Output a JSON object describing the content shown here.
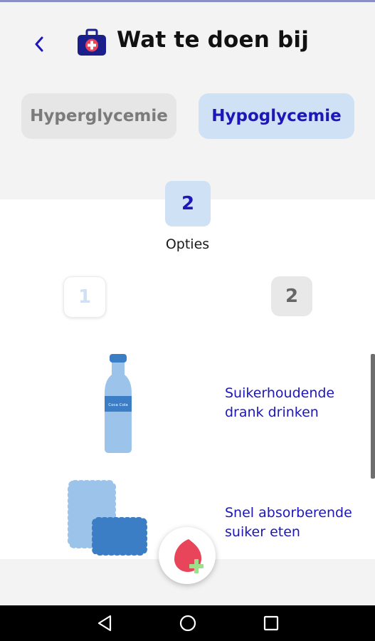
{
  "header": {
    "back_icon": "chevron-left-icon",
    "kit_icon": "first-aid-kit-icon",
    "title": "Wat te doen bij"
  },
  "segments": {
    "hyper_label": "Hyperglycemie",
    "hypo_label": "Hypoglycemie",
    "selected": "Hypoglycemie"
  },
  "options_count": {
    "value": "2",
    "label": "Opties"
  },
  "steps": {
    "step1": "1",
    "step2": "2"
  },
  "options": [
    {
      "icon": "bottle-icon",
      "label": "Suikerhoudende drank drinken",
      "bottle_text": "Coca Cola"
    },
    {
      "icon": "cookies-icon",
      "label": "Snel absorberende suiker eten"
    }
  ],
  "fab": {
    "icon": "blood-drop-plus-icon"
  },
  "navbar": {
    "back_icon": "nav-back-icon",
    "home_icon": "nav-home-icon",
    "recent_icon": "nav-recent-icon"
  },
  "colors": {
    "accent": "#1d17b8",
    "selected_bg": "#cfe1f5",
    "header_bg": "#f3f3f4",
    "drop_red": "#e8455a",
    "plus_green": "#9be08a"
  }
}
